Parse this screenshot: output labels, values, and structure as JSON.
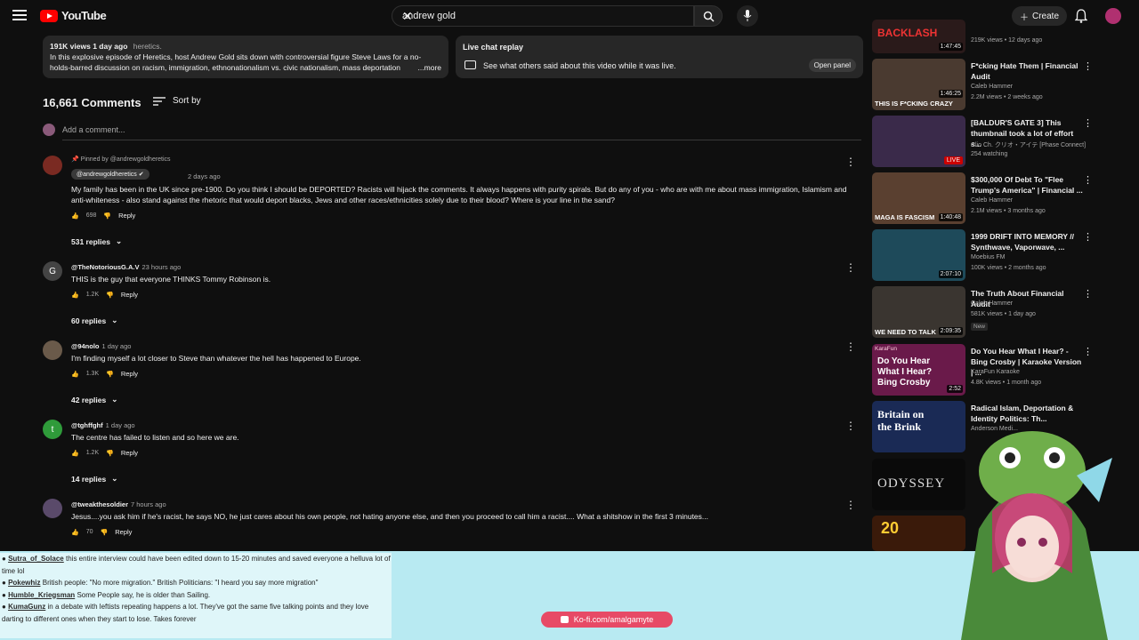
{
  "topbar": {
    "logo": "YouTube",
    "search_value": "andrew gold",
    "create_label": "Create"
  },
  "description": {
    "meta": "191K views  1 day ago",
    "tag": "heretics.",
    "text": "In this explosive episode of Heretics, host Andrew Gold sits down with controversial figure Steve Laws for a no-holds-barred discussion on racism, immigration, ethnonationalism vs. civic nationalism, mass deportation",
    "more": "...more"
  },
  "live_replay": {
    "title": "Live chat replay",
    "subtitle": "See what others said about this video while it was live.",
    "button": "Open panel"
  },
  "comments_header": {
    "count": "16,661 Comments",
    "sort": "Sort by",
    "add_placeholder": "Add a comment..."
  },
  "comments": [
    {
      "pinned": "Pinned by @andrewgoldheretics",
      "author": "@andrewgoldheretics",
      "time": "2 days ago",
      "text": "My family has been in the UK since pre-1900. Do you think I should be DEPORTED? Racists will hijack the comments. It always happens with purity spirals. But do any of you - who are with me about mass immigration, Islamism and anti-whiteness - also stand against the rhetoric that would deport blacks, Jews and other races/ethnicities solely due to their blood? Where is your line in the sand?",
      "likes": "698",
      "reply": "Reply",
      "replies": "531 replies"
    },
    {
      "initial": "G",
      "author": "@TheNotoriousG.A.V",
      "time": "23 hours ago",
      "text": "THIS is the guy that everyone THINKS Tommy Robinson is.",
      "likes": "1.2K",
      "reply": "Reply",
      "replies": "60 replies"
    },
    {
      "author": "@94nolo",
      "time": "1 day ago",
      "text": "I'm finding myself a lot closer to Steve than whatever the hell has happened to Europe.",
      "likes": "1.3K",
      "reply": "Reply",
      "replies": "42 replies"
    },
    {
      "initial": "t",
      "author": "@tghffghf",
      "time": "1 day ago",
      "text": "The centre has failed to listen and so here we are.",
      "likes": "1.2K",
      "reply": "Reply",
      "replies": "14 replies"
    },
    {
      "author": "@tweakthesoldier",
      "time": "7 hours ago",
      "text": "Jesus....you ask him if he's racist, he says NO, he just cares about his own people, not hating anyone else, and then you proceed to call him a racist.... What a shitshow in the first 3 minutes...",
      "likes": "70",
      "reply": "Reply"
    }
  ],
  "sidebar": [
    {
      "title": "",
      "channel": "219K views • 12 days ago",
      "meta": "",
      "duration": "1:47:45",
      "thumb_text": "BACKLASH"
    },
    {
      "title": "F*cking Hate Them | Financial Audit",
      "channel": "Caleb Hammer",
      "meta": "2.2M views • 2 weeks ago",
      "duration": "1:46:25",
      "thumb_text": "THIS IS F*CKING CRAZY"
    },
    {
      "title": "[BALDUR'S GATE 3] This thumbnail took a lot of effort s...",
      "channel": "Clio Ch. クリオ・アイテ [Phase Connect]",
      "meta": "254 watching",
      "live": "LIVE"
    },
    {
      "title": "$300,000 Of Debt To \"Flee Trump's America\" | Financial ...",
      "channel": "Caleb Hammer",
      "meta": "2.1M views • 3 months ago",
      "duration": "1:40:48",
      "thumb_text": "MAGA IS FASCISM"
    },
    {
      "title": "1999 DRIFT INTO MEMORY // Synthwave, Vaporwave, ...",
      "channel": "Moebius FM",
      "meta": "100K views • 2 months ago",
      "duration": "2:07:10"
    },
    {
      "title": "The Truth About Financial Audit",
      "channel": "Caleb Hammer",
      "meta": "581K views • 1 day ago",
      "badge": "New",
      "duration": "2:09:35",
      "thumb_text": "WE NEED TO TALK"
    },
    {
      "title": "Do You Hear What I Hear? - Bing Crosby | Karaoke Version | ...",
      "channel": "KaraFun Karaoke",
      "meta": "4.8K views • 1 month ago",
      "duration": "2:52",
      "thumb_text": "Do You Hear What I Hear? Bing Crosby",
      "thumb_brand": "KaraFun"
    },
    {
      "title": "Radical Islam, Deportation & Identity Politics: Th...",
      "channel": "Anderson Medi...",
      "meta": "",
      "thumb_text": "Britain on the Brink"
    },
    {
      "title": "",
      "channel": "",
      "meta": "",
      "thumb_text": "ODYSSEY"
    },
    {
      "title": "",
      "channel": "",
      "meta": "",
      "thumb_text": "20"
    }
  ],
  "chat": [
    {
      "user": "Sutra_of_Solace",
      "msg": "this entire interview could have been edited down to 15-20 minutes and saved everyone a helluva lot of time lol"
    },
    {
      "user": "Pokewhiz",
      "msg": "British people: \"No more migration.\" British Politicians: \"I heard you say more migration\""
    },
    {
      "user": "Humble_Kriegsman",
      "msg": "Some People say, he is older than Sailing."
    },
    {
      "user": "KumaGunz",
      "msg": "in a debate with leftists repeating happens a lot. They've got the same five talking points and they love darting to different ones when they start to lose. Takes forever"
    }
  ],
  "kofi": "Ko-fi.com/amalgamyte",
  "colors": {
    "brand_red": "#ff0000",
    "overlay": "#b8eaf2",
    "kofi": "#e74a66"
  }
}
